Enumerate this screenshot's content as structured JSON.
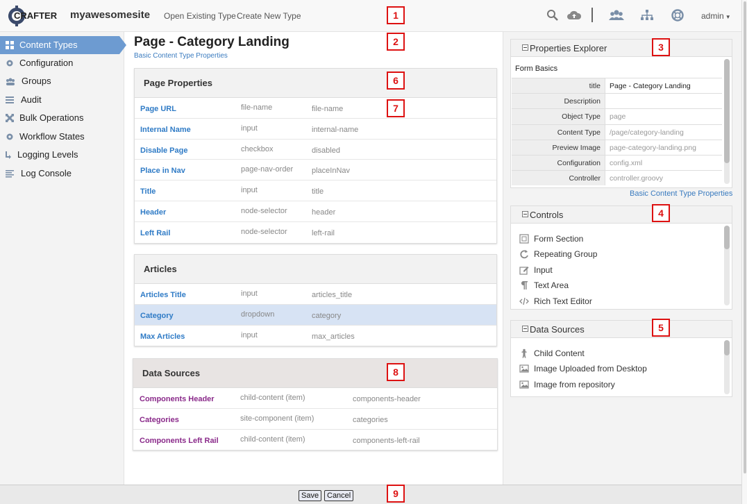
{
  "header": {
    "site_name": "myawesomesite",
    "logo_text": "CRAFTER STUDIO",
    "links": [
      "Open Existing Type",
      "Create New Type"
    ],
    "user": "admin"
  },
  "sidebar": {
    "items": [
      {
        "label": "Content Types",
        "icon": "grid-icon",
        "active": true
      },
      {
        "label": "Configuration",
        "icon": "gear-icon"
      },
      {
        "label": "Groups",
        "icon": "users-icon"
      },
      {
        "label": "Audit",
        "icon": "list-icon"
      },
      {
        "label": "Bulk Operations",
        "icon": "expand-icon"
      },
      {
        "label": "Workflow States",
        "icon": "gear-icon"
      },
      {
        "label": "Logging Levels",
        "icon": "arrow-icon"
      },
      {
        "label": "Log Console",
        "icon": "lines-icon"
      }
    ]
  },
  "main": {
    "title": "Page - Category Landing",
    "subtitle": "Basic Content Type Properties",
    "sections": [
      {
        "title": "Page Properties",
        "rows": [
          {
            "name": "Page URL",
            "type": "file-name",
            "id": "file-name"
          },
          {
            "name": "Internal Name",
            "type": "input",
            "id": "internal-name"
          },
          {
            "name": "Disable Page",
            "type": "checkbox",
            "id": "disabled"
          },
          {
            "name": "Place in Nav",
            "type": "page-nav-order",
            "id": "placeInNav"
          },
          {
            "name": "Title",
            "type": "input",
            "id": "title"
          },
          {
            "name": "Header",
            "type": "node-selector",
            "id": "header"
          },
          {
            "name": "Left Rail",
            "type": "node-selector",
            "id": "left-rail"
          }
        ]
      },
      {
        "title": "Articles",
        "rows": [
          {
            "name": "Articles Title",
            "type": "input",
            "id": "articles_title"
          },
          {
            "name": "Category",
            "type": "dropdown",
            "id": "category",
            "selected": true
          },
          {
            "name": "Max Articles",
            "type": "input",
            "id": "max_articles"
          }
        ]
      }
    ],
    "data_sources": {
      "title": "Data Sources",
      "rows": [
        {
          "name": "Components Header",
          "type": "child-content (item)",
          "id": "components-header"
        },
        {
          "name": "Categories",
          "type": "site-component (item)",
          "id": "categories"
        },
        {
          "name": "Components Left Rail",
          "type": "child-content (item)",
          "id": "components-left-rail"
        }
      ]
    }
  },
  "properties_explorer": {
    "title": "Properties Explorer",
    "group": "Form Basics",
    "rows": [
      {
        "key": "title",
        "value": "Page - Category Landing"
      },
      {
        "key": "Description",
        "value": ""
      },
      {
        "key": "Object Type",
        "value": "page"
      },
      {
        "key": "Content Type",
        "value": "/page/category-landing"
      },
      {
        "key": "Preview Image",
        "value": "page-category-landing.png"
      },
      {
        "key": "Configuration",
        "value": "config.xml"
      },
      {
        "key": "Controller",
        "value": "controller.groovy"
      }
    ],
    "link": "Basic Content Type Properties"
  },
  "controls": {
    "title": "Controls",
    "items": [
      {
        "label": "Form Section",
        "icon": "form-section-icon"
      },
      {
        "label": "Repeating Group",
        "icon": "repeat-icon"
      },
      {
        "label": "Input",
        "icon": "edit-icon"
      },
      {
        "label": "Text Area",
        "icon": "paragraph-icon"
      },
      {
        "label": "Rich Text Editor",
        "icon": "code-icon"
      }
    ]
  },
  "datasources_panel": {
    "title": "Data Sources",
    "items": [
      {
        "label": "Child Content",
        "icon": "child-icon"
      },
      {
        "label": "Image Uploaded from Desktop",
        "icon": "image-icon"
      },
      {
        "label": "Image from repository",
        "icon": "image-icon"
      }
    ]
  },
  "footer": {
    "save": "Save",
    "cancel": "Cancel"
  },
  "annotations": [
    "1",
    "2",
    "3",
    "4",
    "5",
    "6",
    "7",
    "8",
    "9"
  ]
}
